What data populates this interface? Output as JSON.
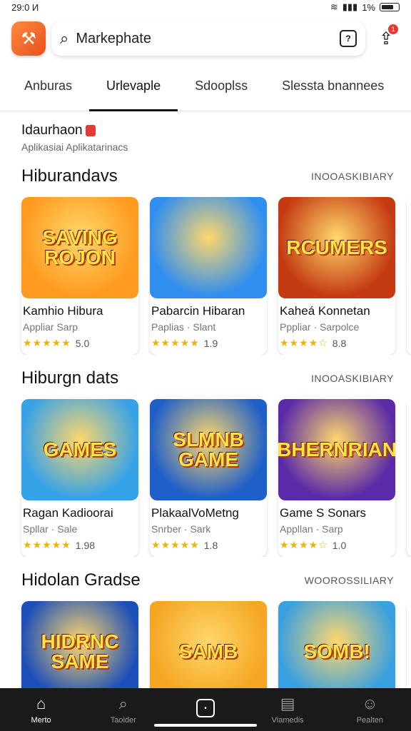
{
  "status": {
    "time": "29:0 И",
    "battery": "1%"
  },
  "header": {
    "search_placeholder": "Markephate",
    "qr_label": "?",
    "notif_count": "1"
  },
  "tabs": [
    {
      "label": "Anburas",
      "active": false
    },
    {
      "label": "Urlevaple",
      "active": true
    },
    {
      "label": "Sdooplss",
      "active": false
    },
    {
      "label": "Slessta bnannees",
      "active": false
    }
  ],
  "promo": {
    "title": "Idaurhaon",
    "subtitle": "Aplikasiai Aplikatarinacs"
  },
  "sections": [
    {
      "title": "Hiburandavs",
      "more": "INOOASKIBIARY",
      "cards": [
        {
          "name": "Kamhio Hibura",
          "sub": "Appliar Sarp",
          "stars": "★★★★★",
          "rating": "5.0",
          "thumb_text": "SAVING ROJON",
          "bg": "#ff9a1f"
        },
        {
          "name": "Pabarcin Hibaran",
          "sub": "Paplias · Slant",
          "stars": "★★★★★",
          "rating": "1.9",
          "thumb_text": "",
          "bg": "#2f8ef0"
        },
        {
          "name": "Kaheá Konnetan",
          "sub": "Pppliar · Sarpolce",
          "stars": "★★★★☆",
          "rating": "8.8",
          "thumb_text": "RCUMERS",
          "bg": "#c43a12"
        }
      ]
    },
    {
      "title": "Hiburgn dats",
      "more": "INOOASKIBIARY",
      "cards": [
        {
          "name": "Ragan Kadioorai",
          "sub": "Spllar · Sale",
          "stars": "★★★★★",
          "rating": "1.98",
          "thumb_text": "GAMES",
          "bg": "#36a2e8"
        },
        {
          "name": "PlakaalVoMetng",
          "sub": "Snrber · Sark",
          "stars": "★★★★★",
          "rating": "1.8",
          "thumb_text": "SLMNB GAME",
          "bg": "#1e5fc9"
        },
        {
          "name": "Game S Sonars",
          "sub": "Appllan · Sarp",
          "stars": "★★★★☆",
          "rating": "1.0",
          "thumb_text": "BHERNRIAN",
          "bg": "#5a2aa8"
        }
      ]
    },
    {
      "title": "Hidolan Gradse",
      "more": "WOOROSSILIARY",
      "cards": [
        {
          "name": "",
          "sub": "",
          "stars": "",
          "rating": "",
          "thumb_text": "HIDRNC SAME",
          "bg": "#1c4fb8"
        },
        {
          "name": "",
          "sub": "",
          "stars": "",
          "rating": "",
          "thumb_text": "SAMB",
          "bg": "#f5a623"
        },
        {
          "name": "",
          "sub": "",
          "stars": "",
          "rating": "",
          "thumb_text": "SOMB!",
          "bg": "#3aa0e0"
        }
      ]
    }
  ],
  "nav": [
    {
      "label": "Merto",
      "icon": "⌂",
      "active": true
    },
    {
      "label": "Taoider",
      "icon": "⌕",
      "active": false
    },
    {
      "label": "",
      "icon": "•",
      "active": false
    },
    {
      "label": "Viamedis",
      "icon": "▤",
      "active": false
    },
    {
      "label": "Pealten",
      "icon": "☺",
      "active": false
    }
  ]
}
